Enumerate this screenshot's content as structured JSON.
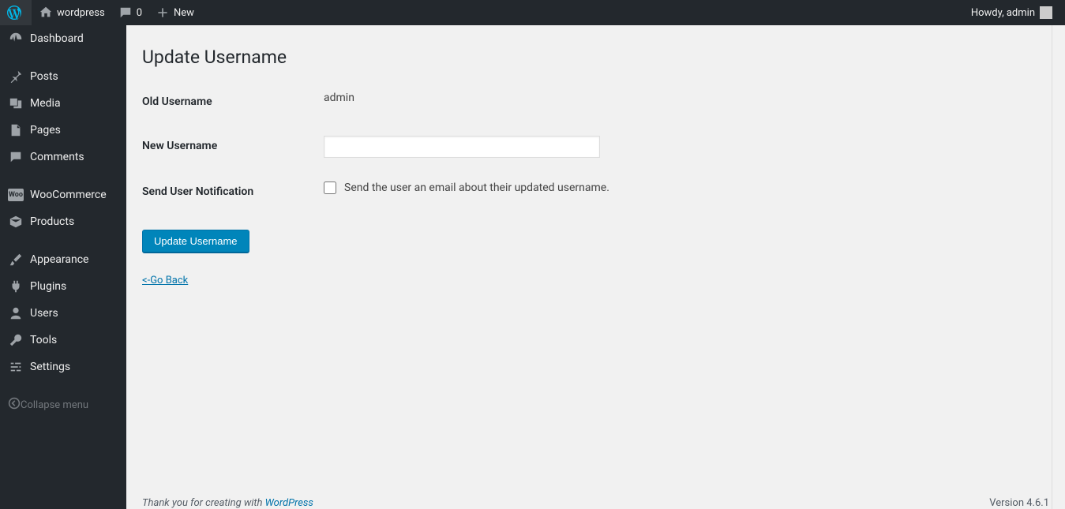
{
  "adminbar": {
    "site_name": "wordpress",
    "comments_count": "0",
    "new_label": "New",
    "howdy": "Howdy, admin"
  },
  "sidebar": {
    "items": [
      {
        "label": "Dashboard"
      },
      {
        "label": "Posts"
      },
      {
        "label": "Media"
      },
      {
        "label": "Pages"
      },
      {
        "label": "Comments"
      },
      {
        "label": "WooCommerce"
      },
      {
        "label": "Products"
      },
      {
        "label": "Appearance"
      },
      {
        "label": "Plugins"
      },
      {
        "label": "Users"
      },
      {
        "label": "Tools"
      },
      {
        "label": "Settings"
      }
    ],
    "collapse_label": "Collapse menu"
  },
  "page": {
    "title": "Update Username",
    "fields": {
      "old_username_label": "Old Username",
      "old_username_value": "admin",
      "new_username_label": "New Username",
      "new_username_value": "",
      "notification_label": "Send User Notification",
      "notification_checkbox_text": "Send the user an email about their updated username."
    },
    "submit_label": "Update Username",
    "go_back_label": "<-Go Back"
  },
  "footer": {
    "thank_you_prefix": "Thank you for creating with ",
    "thank_you_link": "WordPress",
    "version": "Version 4.6.1"
  }
}
